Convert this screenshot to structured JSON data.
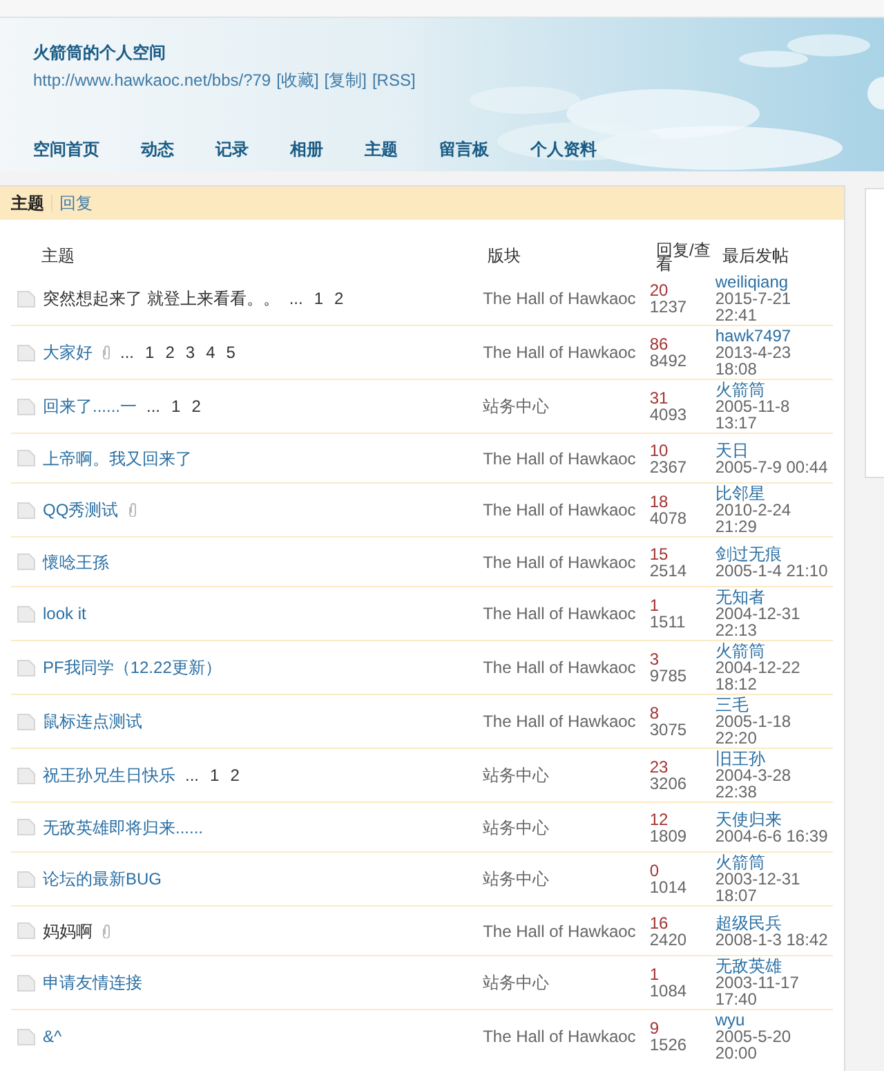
{
  "header": {
    "title": "火箭筒的个人空间",
    "url": "http://www.hawkaoc.net/bbs/?79",
    "links": [
      "[收藏]",
      "[复制]",
      "[RSS]"
    ],
    "nav": [
      "空间首页",
      "动态",
      "记录",
      "相册",
      "主题",
      "留言板",
      "个人资料"
    ]
  },
  "tabs": [
    {
      "label": "主题",
      "selected": true
    },
    {
      "label": "回复",
      "selected": false
    }
  ],
  "table": {
    "columns": [
      "主题",
      "版块",
      "回复/查看",
      "最后发帖"
    ],
    "rows": [
      {
        "title": "突然想起来了 就登上来看看。。",
        "visited": true,
        "attachment": false,
        "pages": [
          "...",
          "1",
          "2"
        ],
        "forum": "The Hall of Hawkaoc",
        "replies": "20",
        "views": "1237",
        "last_user": "weiliqiang",
        "last_time": "2015-7-21 22:41"
      },
      {
        "title": "大家好",
        "visited": false,
        "attachment": true,
        "pages": [
          "...",
          "1",
          "2",
          "3",
          "4",
          "5"
        ],
        "forum": "The Hall of Hawkaoc",
        "replies": "86",
        "views": "8492",
        "last_user": "hawk7497",
        "last_time": "2013-4-23 18:08"
      },
      {
        "title": "回来了......一",
        "visited": false,
        "attachment": false,
        "pages": [
          "...",
          "1",
          "2"
        ],
        "forum": "站务中心",
        "replies": "31",
        "views": "4093",
        "last_user": "火箭筒",
        "last_time": "2005-11-8 13:17"
      },
      {
        "title": "上帝啊。我又回来了",
        "visited": false,
        "attachment": false,
        "pages": [],
        "forum": "The Hall of Hawkaoc",
        "replies": "10",
        "views": "2367",
        "last_user": "天日",
        "last_time": "2005-7-9 00:44"
      },
      {
        "title": "QQ秀测试",
        "visited": false,
        "attachment": true,
        "pages": [],
        "forum": "The Hall of Hawkaoc",
        "replies": "18",
        "views": "4078",
        "last_user": "比邻星",
        "last_time": "2010-2-24 21:29"
      },
      {
        "title": "懷唸王孫",
        "visited": false,
        "attachment": false,
        "pages": [],
        "forum": "The Hall of Hawkaoc",
        "replies": "15",
        "views": "2514",
        "last_user": "剑过无痕",
        "last_time": "2005-1-4 21:10"
      },
      {
        "title": "look it",
        "visited": false,
        "attachment": false,
        "pages": [],
        "forum": "The Hall of Hawkaoc",
        "replies": "1",
        "views": "1511",
        "last_user": "无知者",
        "last_time": "2004-12-31 22:13"
      },
      {
        "title": "PF我同学（12.22更新）",
        "visited": false,
        "attachment": false,
        "pages": [],
        "forum": "The Hall of Hawkaoc",
        "replies": "3",
        "views": "9785",
        "last_user": "火箭筒",
        "last_time": "2004-12-22 18:12"
      },
      {
        "title": "鼠标连点测试",
        "visited": false,
        "attachment": false,
        "pages": [],
        "forum": "The Hall of Hawkaoc",
        "replies": "8",
        "views": "3075",
        "last_user": "三毛",
        "last_time": "2005-1-18 22:20"
      },
      {
        "title": "祝王孙兄生日快乐",
        "visited": false,
        "attachment": false,
        "pages": [
          "...",
          "1",
          "2"
        ],
        "forum": "站务中心",
        "replies": "23",
        "views": "3206",
        "last_user": "旧王孙",
        "last_time": "2004-3-28 22:38"
      },
      {
        "title": "无敌英雄即将归来......",
        "visited": false,
        "attachment": false,
        "pages": [],
        "forum": "站务中心",
        "replies": "12",
        "views": "1809",
        "last_user": "天使归来",
        "last_time": "2004-6-6 16:39"
      },
      {
        "title": "论坛的最新BUG",
        "visited": false,
        "attachment": false,
        "pages": [],
        "forum": "站务中心",
        "replies": "0",
        "views": "1014",
        "last_user": "火箭筒",
        "last_time": "2003-12-31 18:07"
      },
      {
        "title": "妈妈啊",
        "visited": true,
        "attachment": true,
        "pages": [],
        "forum": "The Hall of Hawkaoc",
        "replies": "16",
        "views": "2420",
        "last_user": "超级民兵",
        "last_time": "2008-1-3 18:42"
      },
      {
        "title": "申请友情连接",
        "visited": false,
        "attachment": false,
        "pages": [],
        "forum": "站务中心",
        "replies": "1",
        "views": "1084",
        "last_user": "无敌英雄",
        "last_time": "2003-11-17 17:40"
      },
      {
        "title": "&^",
        "visited": false,
        "attachment": false,
        "pages": [],
        "forum": "The Hall of Hawkaoc",
        "replies": "9",
        "views": "1526",
        "last_user": "wyu",
        "last_time": "2005-5-20 20:00"
      }
    ]
  }
}
